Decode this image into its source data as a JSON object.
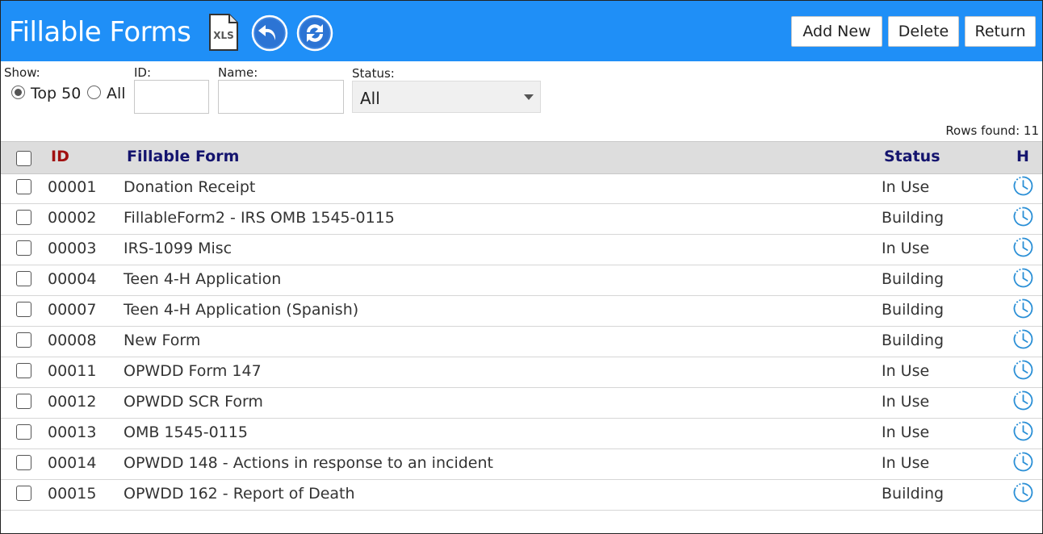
{
  "header": {
    "title": "Fillable Forms",
    "xls_label": "XLS",
    "add_new_label": "Add New",
    "delete_label": "Delete",
    "return_label": "Return"
  },
  "filters": {
    "show_label": "Show:",
    "show_options": [
      "Top 50",
      "All"
    ],
    "show_selected": "Top 50",
    "id_label": "ID:",
    "id_value": "",
    "name_label": "Name:",
    "name_value": "",
    "status_label": "Status:",
    "status_value": "All"
  },
  "rows_found": "Rows found: 11",
  "table": {
    "columns": [
      "ID",
      "Fillable Form",
      "Status",
      "H"
    ],
    "rows": [
      {
        "id": "00001",
        "form": "Donation Receipt",
        "status": "In Use"
      },
      {
        "id": "00002",
        "form": "FillableForm2 - IRS OMB 1545-0115",
        "status": "Building"
      },
      {
        "id": "00003",
        "form": "IRS-1099 Misc",
        "status": "In Use"
      },
      {
        "id": "00004",
        "form": "Teen 4-H Application",
        "status": "Building"
      },
      {
        "id": "00007",
        "form": "Teen 4-H Application (Spanish)",
        "status": "Building"
      },
      {
        "id": "00008",
        "form": "New Form",
        "status": "Building"
      },
      {
        "id": "00011",
        "form": "OPWDD Form 147",
        "status": "In Use"
      },
      {
        "id": "00012",
        "form": "OPWDD SCR Form",
        "status": "In Use"
      },
      {
        "id": "00013",
        "form": "OMB 1545-0115",
        "status": "In Use"
      },
      {
        "id": "00014",
        "form": "OPWDD 148 - Actions in response to an incident",
        "status": "In Use"
      },
      {
        "id": "00015",
        "form": "OPWDD 162 - Report of Death",
        "status": "Building"
      }
    ]
  },
  "colors": {
    "header_bg": "#1f8ff7",
    "id_header": "#a11010",
    "column_header": "#14146e",
    "history_icon": "#2a8fd6"
  },
  "icons": [
    "xls-export-icon",
    "undo-icon",
    "refresh-icon",
    "history-clock-icon"
  ]
}
